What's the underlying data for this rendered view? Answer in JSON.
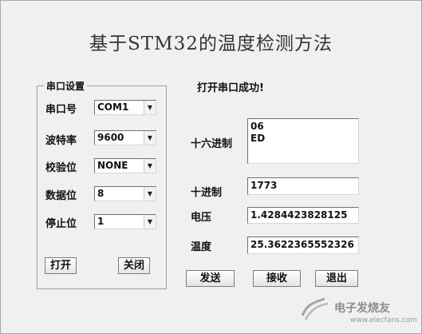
{
  "window": {
    "title": "基于STM32的温度检测方法"
  },
  "serial_settings": {
    "legend": "串口设置",
    "port_label": "串口号",
    "port_value": "COM1",
    "baud_label": "波特率",
    "baud_value": "9600",
    "parity_label": "校验位",
    "parity_value": "NONE",
    "data_bits_label": "数据位",
    "data_bits_value": "8",
    "stop_bits_label": "停止位",
    "stop_bits_value": "1",
    "open_button": "打开",
    "close_button": "关闭"
  },
  "status": {
    "message": "打开串口成功!"
  },
  "readings": {
    "hex_label": "十六进制",
    "hex_lines": [
      "06",
      "ED"
    ],
    "decimal_label": "十进制",
    "decimal_value": "1773",
    "voltage_label": "电压",
    "voltage_value": "1.4284423828125",
    "temperature_label": "温度",
    "temperature_value": "25.3622365552326"
  },
  "actions": {
    "send": "发送",
    "receive": "接收",
    "exit": "退出"
  },
  "watermark": {
    "text": "电子发烧友",
    "url": "www.elecfans.com"
  },
  "icons": {
    "dropdown": "chevron-down-icon",
    "logo": "watermark-logo-icon"
  }
}
